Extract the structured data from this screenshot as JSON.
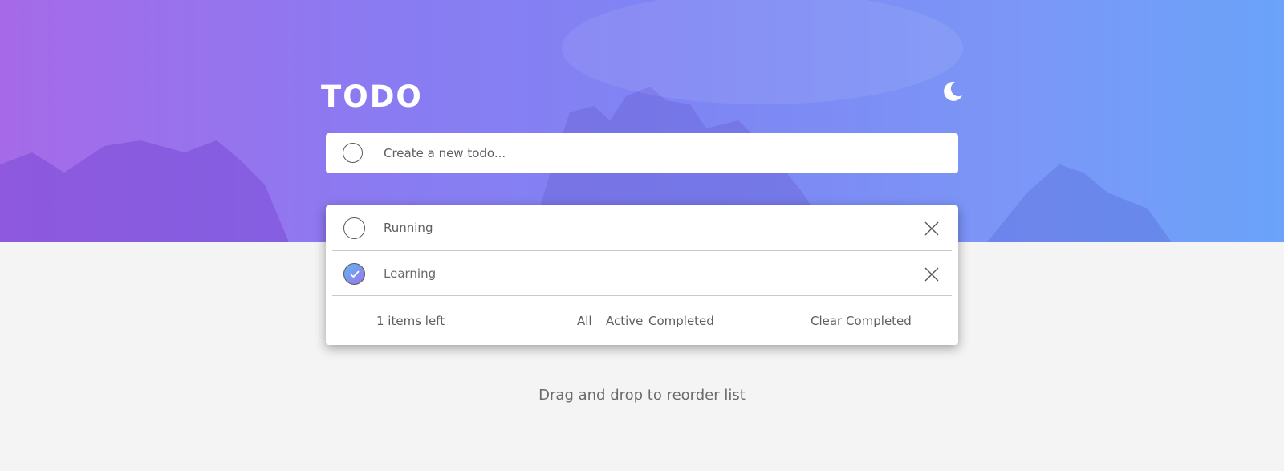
{
  "app": {
    "title": "TODO"
  },
  "new_todo": {
    "placeholder": "Create a new todo..."
  },
  "todos": [
    {
      "label": "Running",
      "completed": false
    },
    {
      "label": "Learning",
      "completed": true
    }
  ],
  "footer": {
    "items_left": "1 items left",
    "filters": [
      "All",
      "Active",
      "Completed"
    ],
    "clear_label": "Clear Completed"
  },
  "hint": "Drag and drop to reorder list",
  "icons": {
    "theme_toggle": "moon-icon",
    "delete": "close-icon",
    "check": "check-icon"
  },
  "colors": {
    "hero_gradient_start": "#a66ae8",
    "hero_gradient_end": "#6aa3f9",
    "check_gradient_start": "#60b8f5",
    "check_gradient_end": "#9a74e8",
    "page_background": "#f4f4f4"
  }
}
